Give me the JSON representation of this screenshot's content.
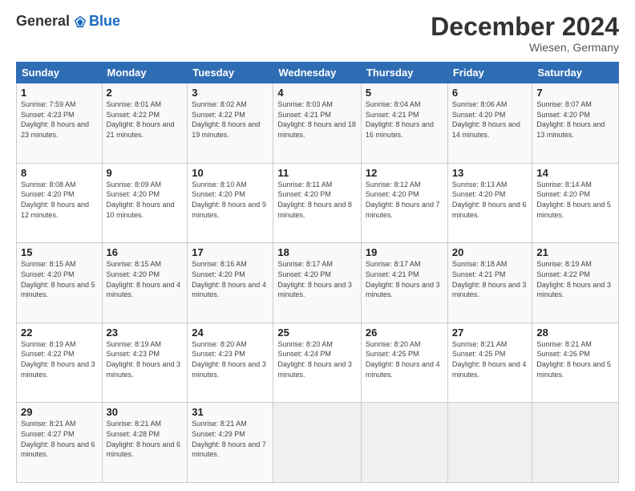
{
  "header": {
    "logo_general": "General",
    "logo_blue": "Blue",
    "month_title": "December 2024",
    "subtitle": "Wiesen, Germany"
  },
  "days_of_week": [
    "Sunday",
    "Monday",
    "Tuesday",
    "Wednesday",
    "Thursday",
    "Friday",
    "Saturday"
  ],
  "weeks": [
    [
      {
        "day": "1",
        "sunrise": "7:59 AM",
        "sunset": "4:23 PM",
        "daylight": "8 hours and 23 minutes."
      },
      {
        "day": "2",
        "sunrise": "8:01 AM",
        "sunset": "4:22 PM",
        "daylight": "8 hours and 21 minutes."
      },
      {
        "day": "3",
        "sunrise": "8:02 AM",
        "sunset": "4:22 PM",
        "daylight": "8 hours and 19 minutes."
      },
      {
        "day": "4",
        "sunrise": "8:03 AM",
        "sunset": "4:21 PM",
        "daylight": "8 hours and 18 minutes."
      },
      {
        "day": "5",
        "sunrise": "8:04 AM",
        "sunset": "4:21 PM",
        "daylight": "8 hours and 16 minutes."
      },
      {
        "day": "6",
        "sunrise": "8:06 AM",
        "sunset": "4:20 PM",
        "daylight": "8 hours and 14 minutes."
      },
      {
        "day": "7",
        "sunrise": "8:07 AM",
        "sunset": "4:20 PM",
        "daylight": "8 hours and 13 minutes."
      }
    ],
    [
      {
        "day": "8",
        "sunrise": "8:08 AM",
        "sunset": "4:20 PM",
        "daylight": "8 hours and 12 minutes."
      },
      {
        "day": "9",
        "sunrise": "8:09 AM",
        "sunset": "4:20 PM",
        "daylight": "8 hours and 10 minutes."
      },
      {
        "day": "10",
        "sunrise": "8:10 AM",
        "sunset": "4:20 PM",
        "daylight": "8 hours and 9 minutes."
      },
      {
        "day": "11",
        "sunrise": "8:11 AM",
        "sunset": "4:20 PM",
        "daylight": "8 hours and 8 minutes."
      },
      {
        "day": "12",
        "sunrise": "8:12 AM",
        "sunset": "4:20 PM",
        "daylight": "8 hours and 7 minutes."
      },
      {
        "day": "13",
        "sunrise": "8:13 AM",
        "sunset": "4:20 PM",
        "daylight": "8 hours and 6 minutes."
      },
      {
        "day": "14",
        "sunrise": "8:14 AM",
        "sunset": "4:20 PM",
        "daylight": "8 hours and 5 minutes."
      }
    ],
    [
      {
        "day": "15",
        "sunrise": "8:15 AM",
        "sunset": "4:20 PM",
        "daylight": "8 hours and 5 minutes."
      },
      {
        "day": "16",
        "sunrise": "8:15 AM",
        "sunset": "4:20 PM",
        "daylight": "8 hours and 4 minutes."
      },
      {
        "day": "17",
        "sunrise": "8:16 AM",
        "sunset": "4:20 PM",
        "daylight": "8 hours and 4 minutes."
      },
      {
        "day": "18",
        "sunrise": "8:17 AM",
        "sunset": "4:20 PM",
        "daylight": "8 hours and 3 minutes."
      },
      {
        "day": "19",
        "sunrise": "8:17 AM",
        "sunset": "4:21 PM",
        "daylight": "8 hours and 3 minutes."
      },
      {
        "day": "20",
        "sunrise": "8:18 AM",
        "sunset": "4:21 PM",
        "daylight": "8 hours and 3 minutes."
      },
      {
        "day": "21",
        "sunrise": "8:19 AM",
        "sunset": "4:22 PM",
        "daylight": "8 hours and 3 minutes."
      }
    ],
    [
      {
        "day": "22",
        "sunrise": "8:19 AM",
        "sunset": "4:22 PM",
        "daylight": "8 hours and 3 minutes."
      },
      {
        "day": "23",
        "sunrise": "8:19 AM",
        "sunset": "4:23 PM",
        "daylight": "8 hours and 3 minutes."
      },
      {
        "day": "24",
        "sunrise": "8:20 AM",
        "sunset": "4:23 PM",
        "daylight": "8 hours and 3 minutes."
      },
      {
        "day": "25",
        "sunrise": "8:20 AM",
        "sunset": "4:24 PM",
        "daylight": "8 hours and 3 minutes."
      },
      {
        "day": "26",
        "sunrise": "8:20 AM",
        "sunset": "4:25 PM",
        "daylight": "8 hours and 4 minutes."
      },
      {
        "day": "27",
        "sunrise": "8:21 AM",
        "sunset": "4:25 PM",
        "daylight": "8 hours and 4 minutes."
      },
      {
        "day": "28",
        "sunrise": "8:21 AM",
        "sunset": "4:26 PM",
        "daylight": "8 hours and 5 minutes."
      }
    ],
    [
      {
        "day": "29",
        "sunrise": "8:21 AM",
        "sunset": "4:27 PM",
        "daylight": "8 hours and 6 minutes."
      },
      {
        "day": "30",
        "sunrise": "8:21 AM",
        "sunset": "4:28 PM",
        "daylight": "8 hours and 6 minutes."
      },
      {
        "day": "31",
        "sunrise": "8:21 AM",
        "sunset": "4:29 PM",
        "daylight": "8 hours and 7 minutes."
      },
      null,
      null,
      null,
      null
    ]
  ]
}
